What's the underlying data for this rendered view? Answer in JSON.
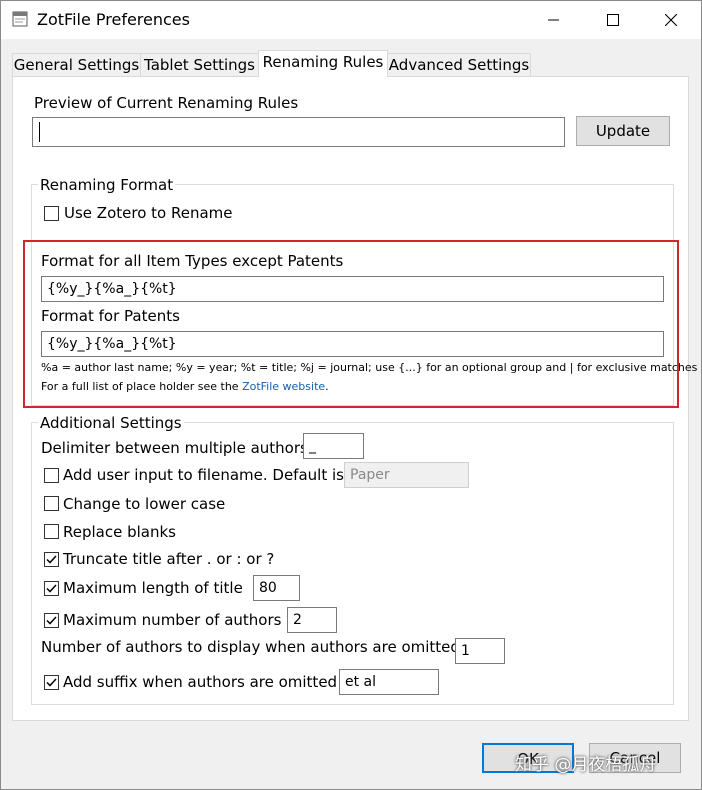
{
  "window": {
    "title": "ZotFile Preferences"
  },
  "tabs": [
    {
      "label": "General Settings"
    },
    {
      "label": "Tablet Settings"
    },
    {
      "label": "Renaming Rules"
    },
    {
      "label": "Advanced Settings"
    }
  ],
  "active_tab": "Renaming Rules",
  "preview": {
    "label": "Preview of Current Renaming Rules",
    "value": "",
    "update_label": "Update"
  },
  "renaming_format": {
    "group_label": "Renaming Format",
    "use_zotero_label": "Use Zotero to Rename",
    "use_zotero_checked": false,
    "format_all_label": "Format for all Item Types except Patents",
    "format_all_value": "{%y_}{%a_}{%t}",
    "format_patents_label": "Format for Patents",
    "format_patents_value": "{%y_}{%a_}{%t}",
    "help_line1": "%a = author last name; %y = year; %t = title; %j = journal; use {...} for an optional group and | for exclusive matches",
    "help_line2_prefix": "For a full list of place holder see the ",
    "help_link": "ZotFile website",
    "help_line2_suffix": "."
  },
  "additional": {
    "group_label": "Additional Settings",
    "delimiter_label": "Delimiter between multiple authors",
    "delimiter_value": "_",
    "user_input_label": "Add user input to filename. Default is",
    "user_input_checked": false,
    "user_input_value": "Paper",
    "lower_case_label": "Change to lower case",
    "lower_case_checked": false,
    "replace_blanks_label": "Replace blanks",
    "replace_blanks_checked": false,
    "truncate_label": "Truncate title after . or : or ?",
    "truncate_checked": true,
    "max_title_label": "Maximum length of title",
    "max_title_checked": true,
    "max_title_value": "80",
    "max_authors_label": "Maximum number of authors",
    "max_authors_checked": true,
    "max_authors_value": "2",
    "authors_display_label": "Number of authors to display when authors are omitted",
    "authors_display_value": "1",
    "suffix_label": "Add suffix when authors are omitted",
    "suffix_checked": true,
    "suffix_value": "et al"
  },
  "footer": {
    "ok_label": "OK",
    "cancel_label": "Cancel"
  },
  "watermark": "知乎 @月夜梧孤舟",
  "colors": {
    "highlight": "#d0262d",
    "link": "#1a5fa8",
    "focus": "#0078d7"
  },
  "icons": [
    "app-icon",
    "minimize-icon",
    "maximize-icon",
    "close-icon",
    "checkmark-icon"
  ]
}
